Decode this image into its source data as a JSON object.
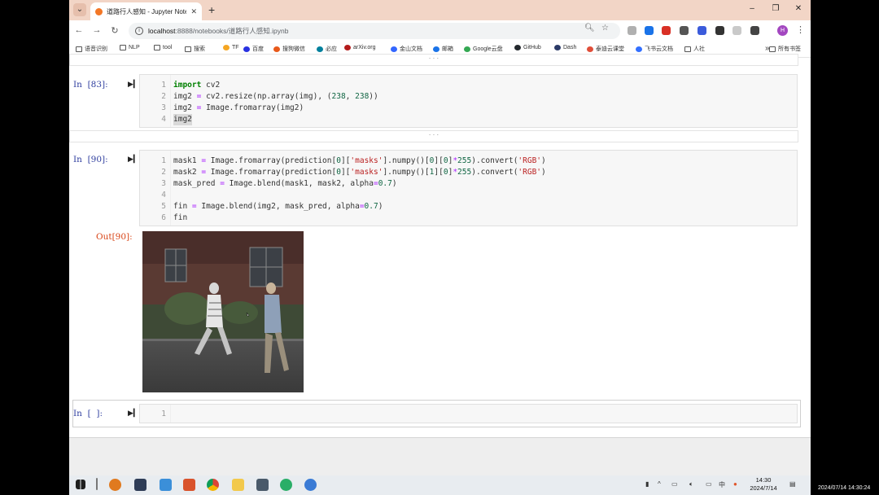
{
  "browser": {
    "tab_title": "道路行人感知 - Jupyter Noteb",
    "tab_close": "✕",
    "new_tab": "+",
    "url_host": "localhost",
    "url_path": ":8888/notebooks/道路行人感知.ipynb",
    "profile_initial": "H",
    "window_controls": {
      "minimize": "–",
      "restore": "❐",
      "close": "✕"
    }
  },
  "bookmarks": {
    "items": [
      {
        "label": "语音识别",
        "color": "#555555"
      },
      {
        "label": "NLP",
        "color": "#555555"
      },
      {
        "label": "tool",
        "color": "#555555"
      },
      {
        "label": "搜索",
        "color": "#555555"
      },
      {
        "label": "TF",
        "color": "#f5a623"
      },
      {
        "label": "百度",
        "color": "#2932e1"
      },
      {
        "label": "搜狗微信",
        "color": "#e8591a"
      },
      {
        "label": "必应",
        "color": "#00809d"
      },
      {
        "label": "arXiv.org",
        "color": "#b31b1b"
      },
      {
        "label": "金山文档",
        "color": "#3366ff"
      },
      {
        "label": "邮箱",
        "color": "#1a73e8"
      },
      {
        "label": "Google云盘",
        "color": "#34a853"
      },
      {
        "label": "GitHub",
        "color": "#24292e"
      },
      {
        "label": "Dash",
        "color": "#2b3a67"
      },
      {
        "label": "泰迪云课堂",
        "color": "#e04e39"
      },
      {
        "label": "飞书云文档",
        "color": "#3370ff"
      },
      {
        "label": "人社",
        "color": "#555555"
      }
    ],
    "overflow": "»",
    "all_bookmarks": "所有书签"
  },
  "notebook": {
    "collapser_text": "· · ·",
    "cells": [
      {
        "prompt": "In  [83]:",
        "lines": [
          {
            "n": "1",
            "code": "import cv2"
          },
          {
            "n": "2",
            "code": "img2 = cv2.resize(np.array(img), (238, 238))"
          },
          {
            "n": "3",
            "code": "img2 = Image.fromarray(img2)"
          },
          {
            "n": "4",
            "code": "img2"
          }
        ]
      },
      {
        "prompt": "In  [90]:",
        "lines": [
          {
            "n": "1",
            "code": "mask1 = Image.fromarray(prediction[0]['masks'].numpy()[0][0]*255).convert('RGB')"
          },
          {
            "n": "2",
            "code": "mask2 = Image.fromarray(prediction[0]['masks'].numpy()[1][0]*255).convert('RGB')"
          },
          {
            "n": "3",
            "code": "mask_pred = Image.blend(mask1, mask2, alpha=0.7)"
          },
          {
            "n": "4",
            "code": ""
          },
          {
            "n": "5",
            "code": "fin = Image.blend(img2, mask_pred, alpha=0.7)"
          },
          {
            "n": "6",
            "code": "fin"
          }
        ],
        "out_prompt": "Out[90]:"
      },
      {
        "prompt": "In  [  ]:",
        "lines": [
          {
            "n": "1",
            "code": ""
          }
        ]
      }
    ]
  },
  "taskbar": {
    "time": "14:30",
    "date": "2024/7/14",
    "lang": "中",
    "overlay_timestamp": "2024/07/14 14:30:24"
  }
}
